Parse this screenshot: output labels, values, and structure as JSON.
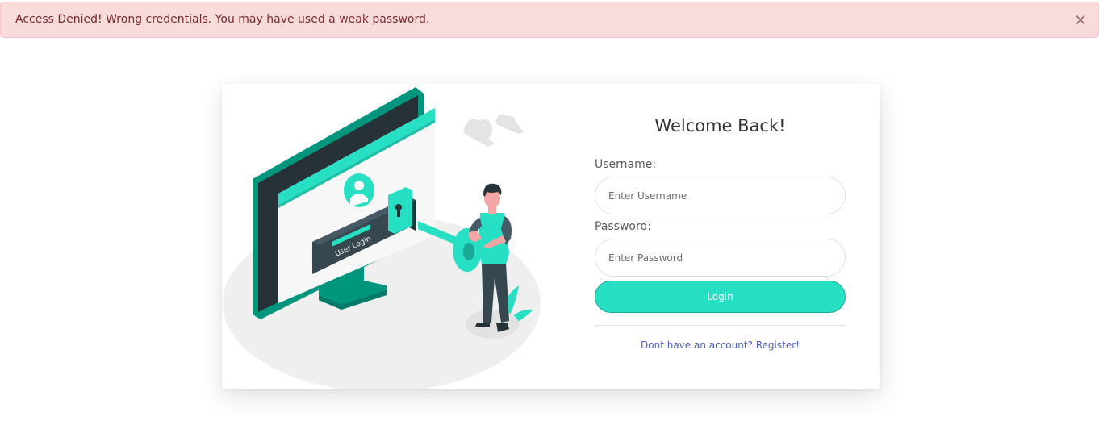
{
  "alert": {
    "message": "Access Denied! Wrong credentials. You may have used a weak password.",
    "close": "×"
  },
  "illustration": {
    "screen_text": "User Login"
  },
  "form": {
    "title": "Welcome Back!",
    "username_label": "Username:",
    "username_placeholder": "Enter Username",
    "password_label": "Password:",
    "password_placeholder": "Enter Password",
    "login_label": "Login",
    "register_link": "Dont have an account? Register!"
  },
  "colors": {
    "accent": "#27dfc3",
    "alert_bg": "#fadbdb",
    "alert_text": "#7d2a2f",
    "link": "#4f5fc9",
    "dark_teal": "#00967d"
  }
}
